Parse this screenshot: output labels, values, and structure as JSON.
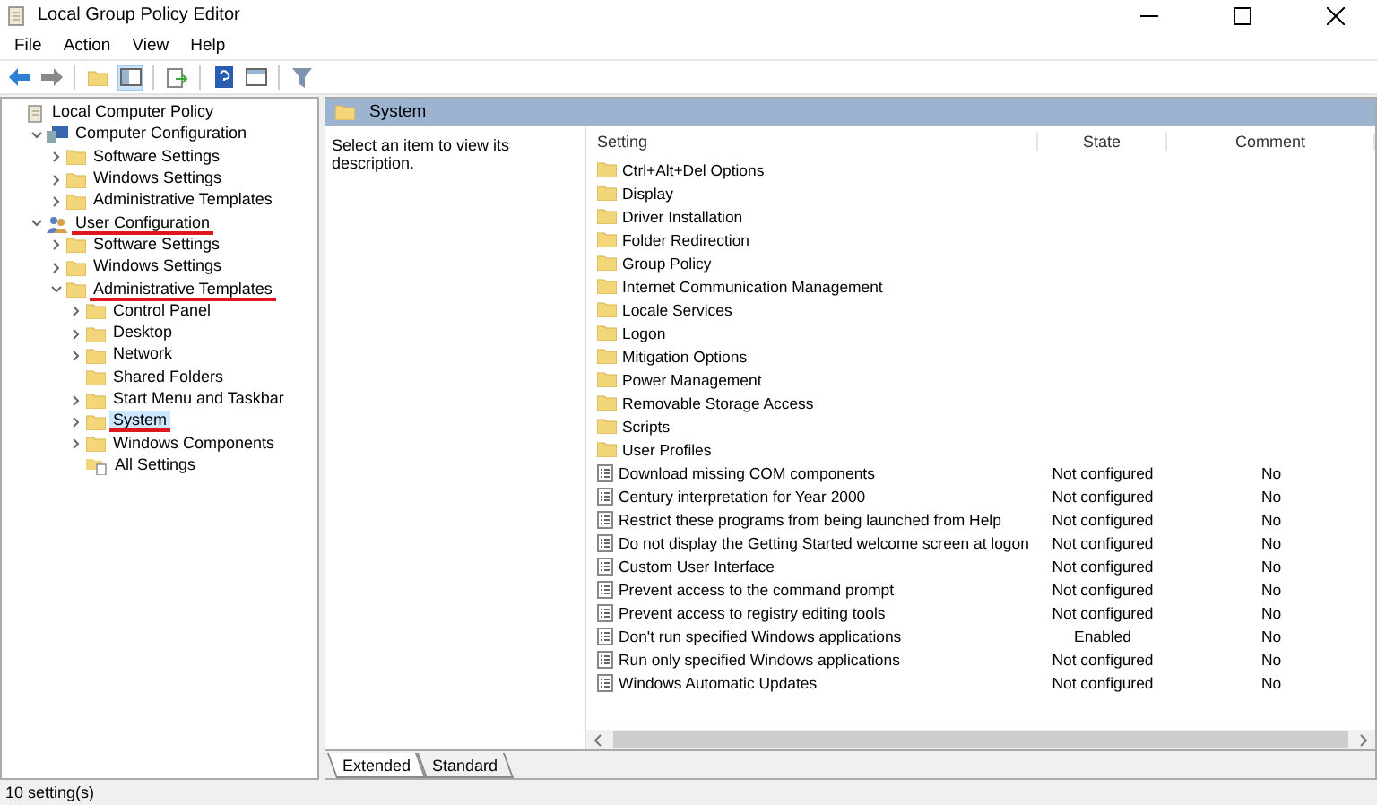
{
  "window": {
    "title": "Local Group Policy Editor"
  },
  "menu": [
    "File",
    "Action",
    "View",
    "Help"
  ],
  "tree": [
    {
      "label": "Local Computer Policy",
      "kind": "policy",
      "selected": false,
      "underlined": false,
      "children": [
        {
          "label": "Computer Configuration",
          "kind": "computer",
          "expanded": true,
          "selected": false,
          "underlined": false,
          "children": [
            {
              "label": "Software Settings",
              "kind": "folder",
              "expanded": false,
              "selected": false,
              "underlined": false
            },
            {
              "label": "Windows Settings",
              "kind": "folder",
              "expanded": false,
              "selected": false,
              "underlined": false
            },
            {
              "label": "Administrative Templates",
              "kind": "folder",
              "expanded": false,
              "selected": false,
              "underlined": false
            }
          ]
        },
        {
          "label": "User Configuration",
          "kind": "user",
          "expanded": true,
          "selected": false,
          "underlined": true,
          "children": [
            {
              "label": "Software Settings",
              "kind": "folder",
              "expanded": false,
              "selected": false,
              "underlined": false
            },
            {
              "label": "Windows Settings",
              "kind": "folder",
              "expanded": false,
              "selected": false,
              "underlined": false
            },
            {
              "label": "Administrative Templates",
              "kind": "folder",
              "expanded": true,
              "selected": false,
              "underlined": true,
              "children": [
                {
                  "label": "Control Panel",
                  "kind": "folder",
                  "expanded": false,
                  "selected": false,
                  "underlined": false
                },
                {
                  "label": "Desktop",
                  "kind": "folder",
                  "expanded": false,
                  "selected": false,
                  "underlined": false
                },
                {
                  "label": "Network",
                  "kind": "folder",
                  "expanded": false,
                  "selected": false,
                  "underlined": false
                },
                {
                  "label": "Shared Folders",
                  "kind": "folder",
                  "selected": false,
                  "underlined": false
                },
                {
                  "label": "Start Menu and Taskbar",
                  "kind": "folder",
                  "expanded": false,
                  "selected": false,
                  "underlined": false
                },
                {
                  "label": "System",
                  "kind": "folder",
                  "expanded": false,
                  "selected": true,
                  "underlined": true
                },
                {
                  "label": "Windows Components",
                  "kind": "folder",
                  "expanded": false,
                  "selected": false,
                  "underlined": false
                },
                {
                  "label": "All Settings",
                  "kind": "settings",
                  "selected": false,
                  "underlined": false
                }
              ]
            }
          ]
        }
      ]
    }
  ],
  "pane": {
    "title": "System",
    "description": "Select an item to view its description."
  },
  "table": {
    "columns": [
      "Setting",
      "State",
      "Comment"
    ],
    "rows": [
      {
        "kind": "folder",
        "setting": "Ctrl+Alt+Del Options"
      },
      {
        "kind": "folder",
        "setting": "Display"
      },
      {
        "kind": "folder",
        "setting": "Driver Installation"
      },
      {
        "kind": "folder",
        "setting": "Folder Redirection"
      },
      {
        "kind": "folder",
        "setting": "Group Policy"
      },
      {
        "kind": "folder",
        "setting": "Internet Communication Management"
      },
      {
        "kind": "folder",
        "setting": "Locale Services"
      },
      {
        "kind": "folder",
        "setting": "Logon"
      },
      {
        "kind": "folder",
        "setting": "Mitigation Options"
      },
      {
        "kind": "folder",
        "setting": "Power Management"
      },
      {
        "kind": "folder",
        "setting": "Removable Storage Access"
      },
      {
        "kind": "folder",
        "setting": "Scripts"
      },
      {
        "kind": "folder",
        "setting": "User Profiles"
      },
      {
        "kind": "setting",
        "setting": "Download missing COM components",
        "state": "Not configured",
        "comment": "No"
      },
      {
        "kind": "setting",
        "setting": "Century interpretation for Year 2000",
        "state": "Not configured",
        "comment": "No"
      },
      {
        "kind": "setting",
        "setting": "Restrict these programs from being launched from Help",
        "state": "Not configured",
        "comment": "No"
      },
      {
        "kind": "setting",
        "setting": "Do not display the Getting Started welcome screen at logon",
        "state": "Not configured",
        "comment": "No"
      },
      {
        "kind": "setting",
        "setting": "Custom User Interface",
        "state": "Not configured",
        "comment": "No"
      },
      {
        "kind": "setting",
        "setting": "Prevent access to the command prompt",
        "state": "Not configured",
        "comment": "No"
      },
      {
        "kind": "setting",
        "setting": "Prevent access to registry editing tools",
        "state": "Not configured",
        "comment": "No"
      },
      {
        "kind": "setting",
        "setting": "Don't run specified Windows applications",
        "state": "Enabled",
        "comment": "No"
      },
      {
        "kind": "setting",
        "setting": "Run only specified Windows applications",
        "state": "Not configured",
        "comment": "No"
      },
      {
        "kind": "setting",
        "setting": "Windows Automatic Updates",
        "state": "Not configured",
        "comment": "No"
      }
    ]
  },
  "tabs": [
    {
      "label": "Extended",
      "selected": true
    },
    {
      "label": "Standard",
      "selected": false
    }
  ],
  "status_bar": "10 setting(s)"
}
